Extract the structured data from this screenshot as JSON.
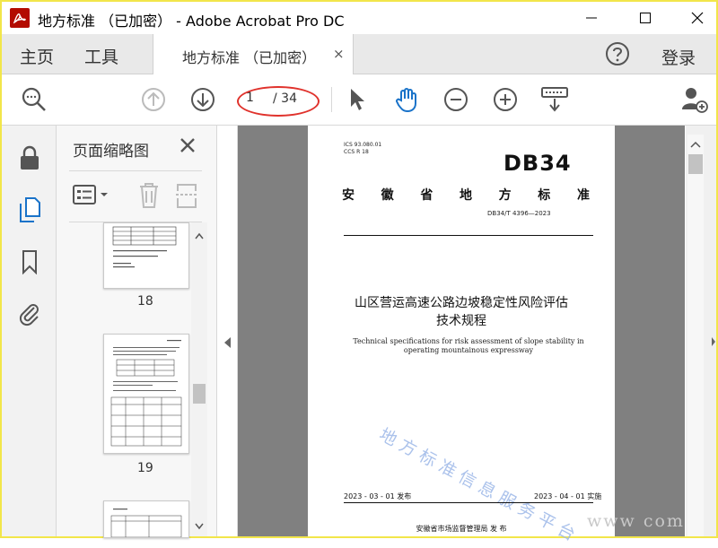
{
  "window": {
    "title": "地方标准 （已加密） - Adobe Acrobat Pro DC"
  },
  "tabs": {
    "home": "主页",
    "tools": "工具",
    "document_tab": "地方标准 （已加密）",
    "close_symbol": "×",
    "login": "登录"
  },
  "toolbar": {
    "current_page": "1",
    "total_pages": "/ 34"
  },
  "thumbnails": {
    "title": "页面缩略图",
    "pages": [
      {
        "label": "18"
      },
      {
        "label": "19"
      }
    ]
  },
  "document": {
    "ics": "ICS  93.080.01",
    "ccs": "CCS  R 18",
    "db_label": "DB34",
    "province_chars": [
      "安",
      "徽",
      "省",
      "地",
      "方",
      "标",
      "准"
    ],
    "code": "DB34/T 4396—2023",
    "title_line1": "山区营运高速公路边坡稳定性风险评估",
    "title_line2": "技术规程",
    "english_title": "Technical specifications for risk assessment of slope stability in operating mountainous expressway",
    "watermark": "地方标准信息服务平台",
    "publish_date": "2023 - 03 - 01 发布",
    "implement_date": "2023 - 04 - 01 实施",
    "issuer": "安徽省市场监督管理局    发 布"
  },
  "site_watermark": "www         com"
}
